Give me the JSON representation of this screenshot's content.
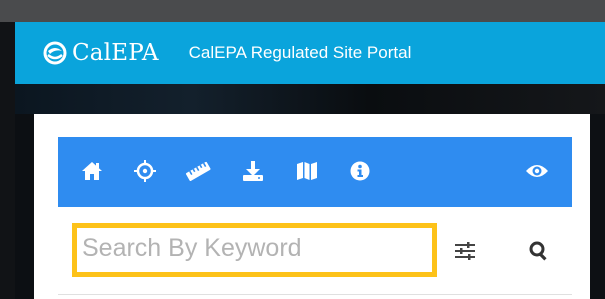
{
  "header": {
    "logo_text": "CalEPA",
    "portal_title": "CalEPA Regulated Site Portal"
  },
  "toolbar": {
    "items": [
      {
        "icon": "home-icon",
        "label": "Home"
      },
      {
        "icon": "crosshairs-icon",
        "label": "Locate"
      },
      {
        "icon": "ruler-icon",
        "label": "Measure"
      },
      {
        "icon": "download-icon",
        "label": "Download"
      },
      {
        "icon": "map-icon",
        "label": "Map"
      },
      {
        "icon": "info-icon",
        "label": "Info"
      },
      {
        "icon": "eye-icon",
        "label": "Visibility"
      }
    ]
  },
  "search": {
    "placeholder": "Search By Keyword",
    "value": "",
    "filter_icon": "sliders-icon",
    "search_icon": "search-icon"
  },
  "colors": {
    "header_bg": "#0aa4dc",
    "toolbar_bg": "#2f8cf0",
    "highlight": "#fdc219"
  }
}
